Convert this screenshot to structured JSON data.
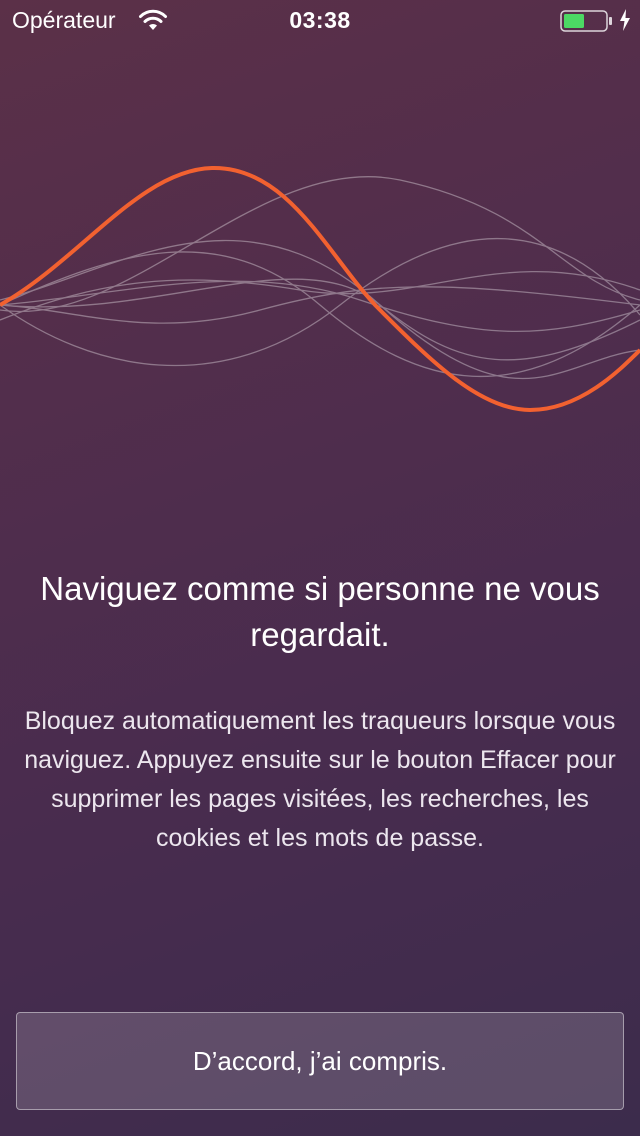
{
  "status_bar": {
    "carrier": "Opérateur",
    "time": "03:38",
    "wifi_icon": "wifi-icon",
    "battery_icon": "battery-charging-icon",
    "battery_color": "#4cd964"
  },
  "illustration": {
    "icon": "sound-waves-illustration",
    "accent_color": "#f26130"
  },
  "onboarding": {
    "title": "Naviguez comme si personne ne vous regardait.",
    "description": "Bloquez automatiquement les traqueurs lorsque vous naviguez. Appuyez ensuite sur le bouton Effacer pour supprimer les pages visitées, les recherches, les cookies et les mots de passe.",
    "button_label": "D’accord, j’ai compris."
  }
}
